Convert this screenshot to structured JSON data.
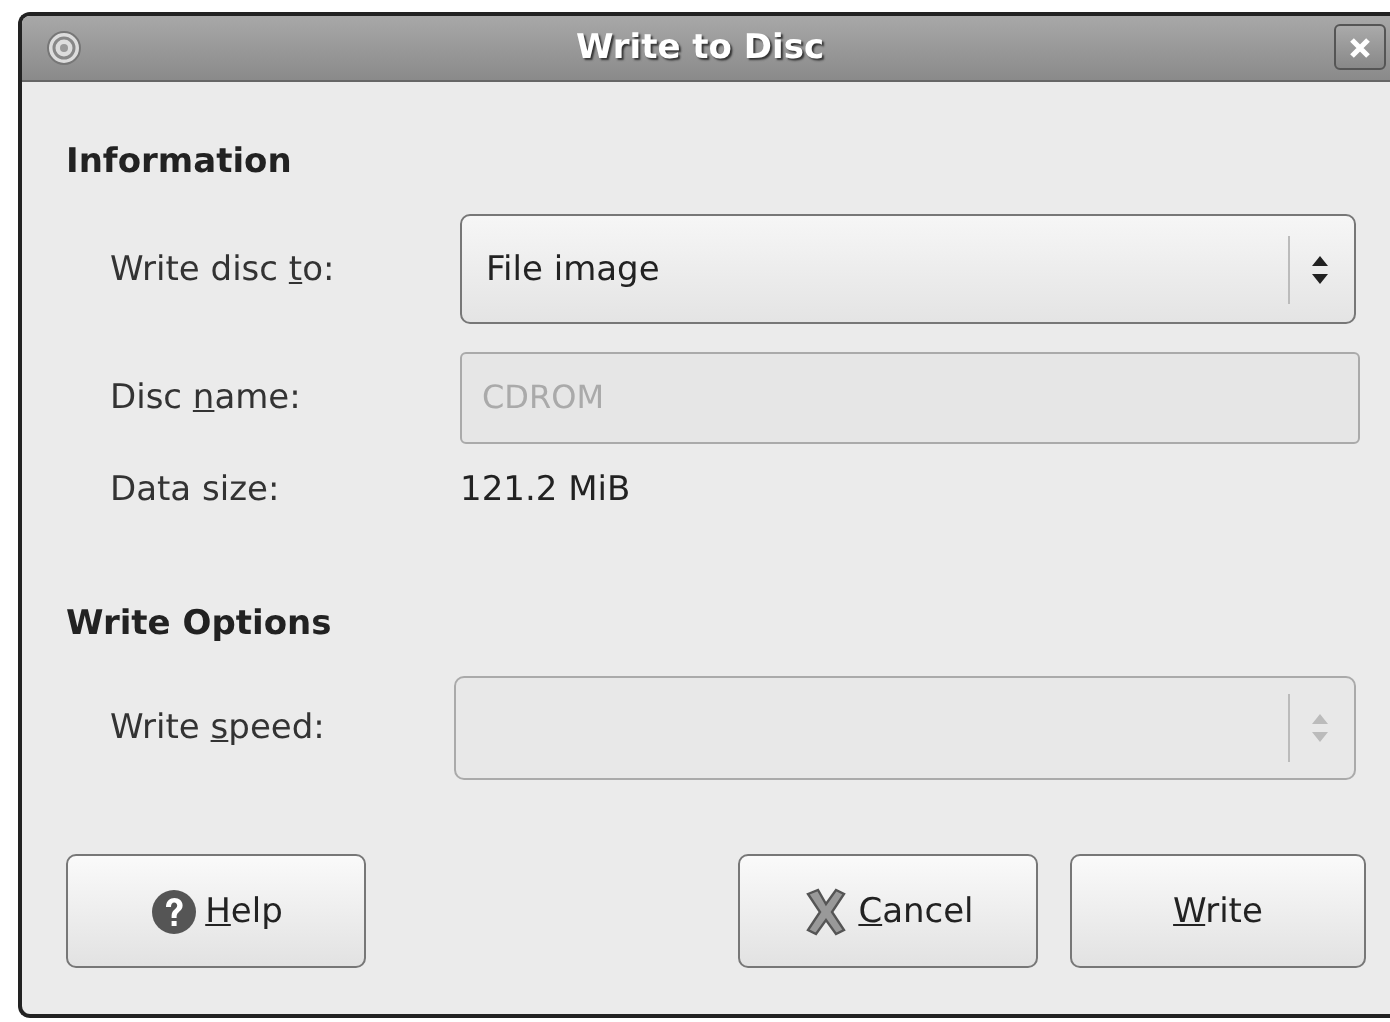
{
  "window": {
    "title": "Write to Disc"
  },
  "sections": [
    {
      "heading": "Information",
      "rows": [
        {
          "kind": "combo",
          "label": {
            "before": "Write disc ",
            "mnemonic": "t",
            "after": "o:"
          },
          "value": "File image",
          "disabled": false
        },
        {
          "kind": "entry",
          "label": {
            "before": "Disc ",
            "mnemonic": "n",
            "after": "ame:"
          },
          "placeholder": "CDROM",
          "disabled": true
        },
        {
          "kind": "text",
          "label": {
            "before": "Data size:"
          },
          "value": "121.2 MiB"
        }
      ]
    },
    {
      "heading": "Write Options",
      "rows": [
        {
          "kind": "combo",
          "label": {
            "before": "Write ",
            "mnemonic": "s",
            "after": "peed:"
          },
          "disabled": true
        }
      ]
    }
  ],
  "buttons": [
    {
      "kind": "help",
      "label": {
        "mnemonic": "H",
        "after": "elp"
      }
    },
    {
      "kind": "cancel",
      "label": {
        "mnemonic": "C",
        "after": "ancel"
      }
    },
    {
      "kind": "plain",
      "label": {
        "mnemonic": "W",
        "after": "rite"
      }
    }
  ]
}
